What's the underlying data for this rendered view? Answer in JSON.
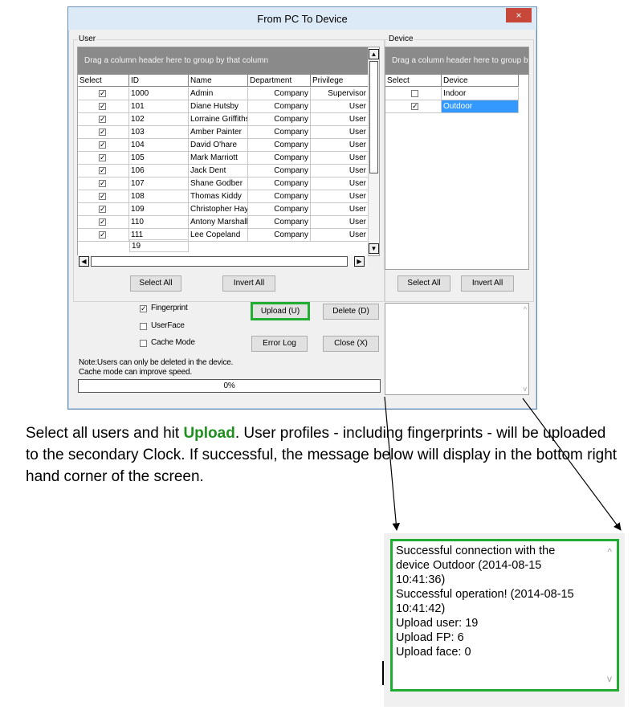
{
  "window": {
    "title": "From PC To Device",
    "close_glyph": "×"
  },
  "user_group": {
    "legend": "User",
    "drag_hint": "Drag a column header here to group by that column",
    "columns": [
      "Select",
      "ID",
      "Name",
      "Department",
      "Privilege"
    ],
    "rows": [
      {
        "id": "1000",
        "name": "Admin",
        "dept": "Company",
        "priv": "Supervisor"
      },
      {
        "id": "101",
        "name": "Diane Hutsby",
        "dept": "Company",
        "priv": "User"
      },
      {
        "id": "102",
        "name": "Lorraine Griffiths",
        "dept": "Company",
        "priv": "User"
      },
      {
        "id": "103",
        "name": "Amber Painter",
        "dept": "Company",
        "priv": "User"
      },
      {
        "id": "104",
        "name": "David O'hare",
        "dept": "Company",
        "priv": "User"
      },
      {
        "id": "105",
        "name": "Mark Marriott",
        "dept": "Company",
        "priv": "User"
      },
      {
        "id": "106",
        "name": "Jack Dent",
        "dept": "Company",
        "priv": "User"
      },
      {
        "id": "107",
        "name": "Shane Godber",
        "dept": "Company",
        "priv": "User"
      },
      {
        "id": "108",
        "name": "Thomas Kiddy",
        "dept": "Company",
        "priv": "User"
      },
      {
        "id": "109",
        "name": "Christopher Hay",
        "dept": "Company",
        "priv": "User"
      },
      {
        "id": "110",
        "name": "Antony Marshall",
        "dept": "Company",
        "priv": "User"
      },
      {
        "id": "111",
        "name": "Lee Copeland",
        "dept": "Company",
        "priv": "User"
      }
    ],
    "count": "19",
    "select_all": "Select All",
    "invert_all": "Invert All"
  },
  "device_group": {
    "legend": "Device",
    "drag_hint": "Drag a column header here to group by",
    "columns": [
      "Select",
      "Device"
    ],
    "rows": [
      {
        "name": "Indoor",
        "checked": false,
        "selected": false
      },
      {
        "name": "Outdoor",
        "checked": true,
        "selected": true
      }
    ],
    "select_all": "Select All",
    "invert_all": "Invert All"
  },
  "options": {
    "fingerprint": "Fingerprint",
    "userface": "UserFace",
    "cache_mode": "Cache Mode",
    "fingerprint_checked": true
  },
  "actions": {
    "upload": "Upload (U)",
    "delete": "Delete (D)",
    "error_log": "Error Log",
    "close": "Close (X)"
  },
  "notes": {
    "line1": "Note:Users can only be deleted in the device.",
    "line2": "Cache mode can improve speed."
  },
  "progress": {
    "text": "0%",
    "value": 0
  },
  "caption": {
    "pre": "Select all users and hit ",
    "bold": "Upload",
    "post": ". User profiles - including fingerprints - will be uploaded to the secondary Clock. If successful, the message below will display in the bottom right hand corner of the screen."
  },
  "result_lines": [
    "Successful connection with the",
    "device Outdoor (2014-08-15",
    "10:41:36)",
    "Successful operation! (2014-08-15",
    "10:41:42)",
    "Upload user: 19",
    "Upload FP: 6",
    "Upload face: 0"
  ],
  "colors": {
    "highlight": "#21ad31",
    "selection": "#3399ff",
    "drag_bar": "#8a8a8a"
  }
}
